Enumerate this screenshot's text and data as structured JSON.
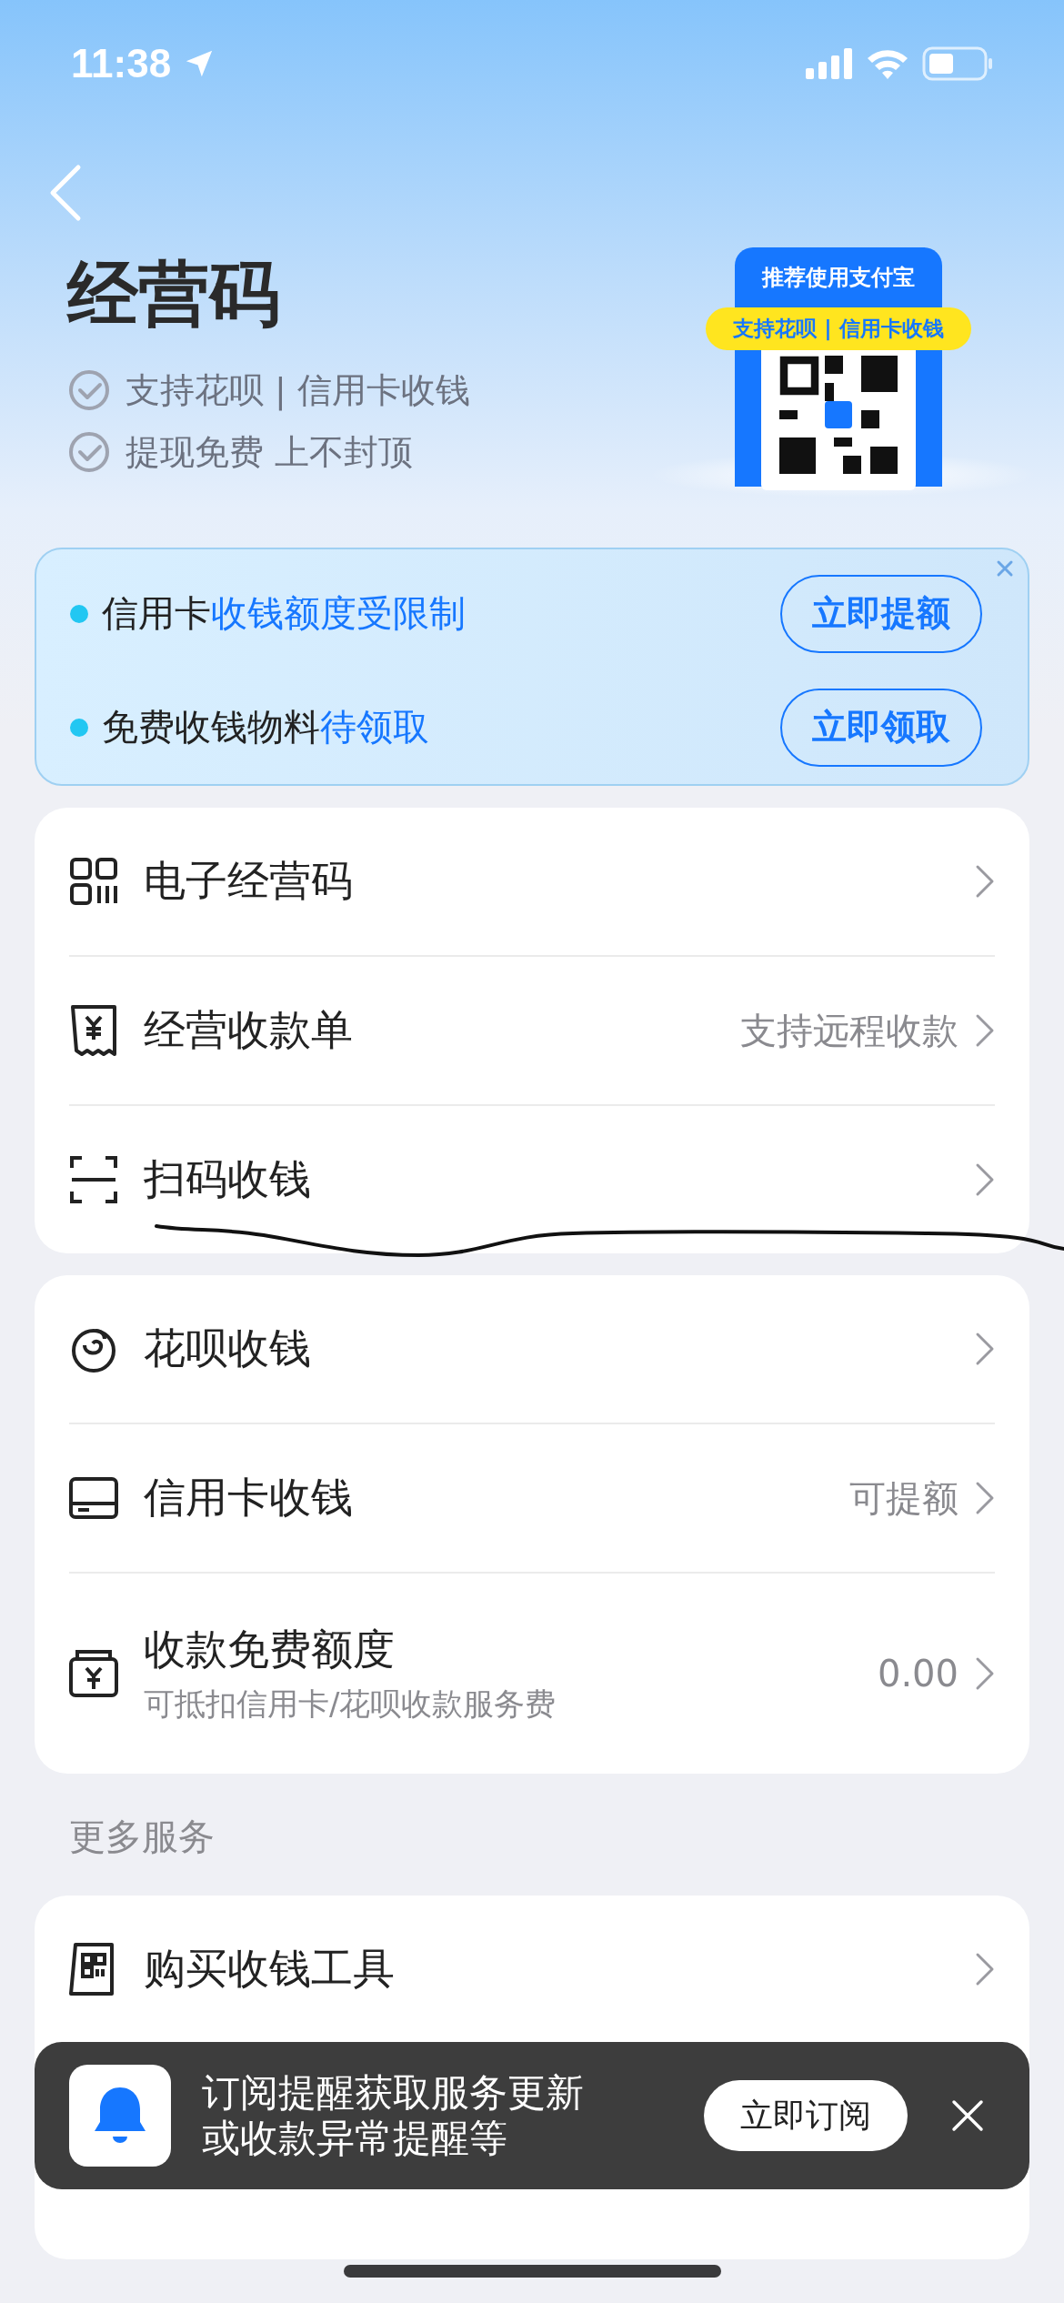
{
  "status_bar": {
    "time": "11:38"
  },
  "header": {
    "title": "经营码",
    "features": [
      "支持花呗 | 信用卡收钱",
      "提现免费 上不封顶"
    ],
    "promo_card": {
      "heading": "推荐使用支付宝",
      "ribbon": "支持花呗 | 信用卡收钱"
    }
  },
  "notice": {
    "rows": [
      {
        "text": "信用卡",
        "highlight": "收钱额度受限制",
        "button": "立即提额"
      },
      {
        "text": "免费收钱物料",
        "highlight": "待领取",
        "button": "立即领取"
      }
    ]
  },
  "groups": [
    {
      "items": [
        {
          "label": "电子经营码"
        },
        {
          "label": "经营收款单",
          "detail": "支持远程收款"
        },
        {
          "label": "扫码收钱"
        }
      ]
    },
    {
      "items": [
        {
          "label": "花呗收钱"
        },
        {
          "label": "信用卡收钱",
          "detail": "可提额"
        },
        {
          "label": "收款免费额度",
          "sublabel": "可抵扣信用卡/花呗收款服务费",
          "detail": "0.00"
        }
      ]
    }
  ],
  "more_services": {
    "title": "更多服务",
    "items": [
      {
        "label": "购买收钱工具"
      }
    ]
  },
  "toast": {
    "lines": [
      "订阅提醒获取服务更新",
      "或收款异常提醒等"
    ],
    "button": "立即订阅"
  }
}
